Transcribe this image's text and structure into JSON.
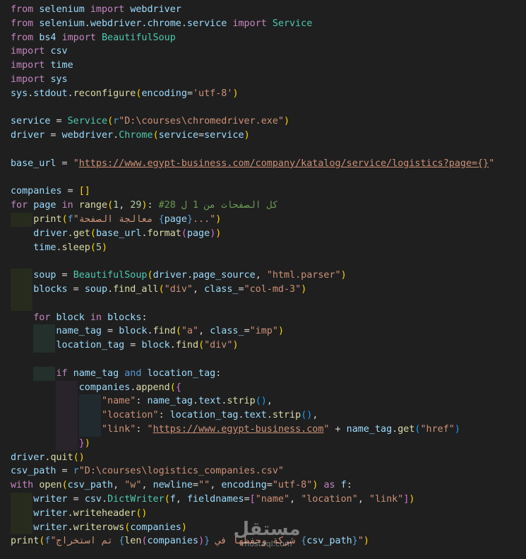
{
  "code_lines": [
    [
      [
        "k",
        "from"
      ],
      [
        "p",
        " "
      ],
      [
        "v",
        "selenium"
      ],
      [
        "p",
        " "
      ],
      [
        "k",
        "import"
      ],
      [
        "p",
        " "
      ],
      [
        "v",
        "webdriver"
      ]
    ],
    [
      [
        "k",
        "from"
      ],
      [
        "p",
        " "
      ],
      [
        "v",
        "selenium.webdriver.chrome.service"
      ],
      [
        "p",
        " "
      ],
      [
        "k",
        "import"
      ],
      [
        "p",
        " "
      ],
      [
        "c",
        "Service"
      ]
    ],
    [
      [
        "k",
        "from"
      ],
      [
        "p",
        " "
      ],
      [
        "v",
        "bs4"
      ],
      [
        "p",
        " "
      ],
      [
        "k",
        "import"
      ],
      [
        "p",
        " "
      ],
      [
        "c",
        "BeautifulSoup"
      ]
    ],
    [
      [
        "k",
        "import"
      ],
      [
        "p",
        " "
      ],
      [
        "v",
        "csv"
      ]
    ],
    [
      [
        "k",
        "import"
      ],
      [
        "p",
        " "
      ],
      [
        "v",
        "time"
      ]
    ],
    [
      [
        "k",
        "import"
      ],
      [
        "p",
        " "
      ],
      [
        "v",
        "sys"
      ]
    ],
    [
      [
        "v",
        "sys"
      ],
      [
        "p",
        "."
      ],
      [
        "v",
        "stdout"
      ],
      [
        "p",
        "."
      ],
      [
        "f",
        "reconfigure"
      ],
      [
        "p1",
        "("
      ],
      [
        "v",
        "encoding"
      ],
      [
        "p",
        "="
      ],
      [
        "s",
        "'utf-8'"
      ],
      [
        "p1",
        ")"
      ]
    ],
    [],
    [
      [
        "v",
        "service"
      ],
      [
        "p",
        " = "
      ],
      [
        "c",
        "Service"
      ],
      [
        "p1",
        "("
      ],
      [
        "b",
        "r"
      ],
      [
        "s",
        "\"D:\\courses\\chromedriver.exe\""
      ],
      [
        "p1",
        ")"
      ]
    ],
    [
      [
        "v",
        "driver"
      ],
      [
        "p",
        " = "
      ],
      [
        "v",
        "webdriver"
      ],
      [
        "p",
        "."
      ],
      [
        "c",
        "Chrome"
      ],
      [
        "p1",
        "("
      ],
      [
        "v",
        "service"
      ],
      [
        "p",
        "="
      ],
      [
        "v",
        "service"
      ],
      [
        "p1",
        ")"
      ]
    ],
    [],
    [
      [
        "v",
        "base_url"
      ],
      [
        "p",
        " = "
      ],
      [
        "s",
        "\""
      ],
      [
        "su",
        "https://www.egypt-business.com/company/katalog/service/logistics?page={}"
      ],
      [
        "s",
        "\""
      ]
    ],
    [],
    [
      [
        "v",
        "companies"
      ],
      [
        "p",
        " = "
      ],
      [
        "p1",
        "[]"
      ]
    ],
    [
      [
        "k",
        "for"
      ],
      [
        "p",
        " "
      ],
      [
        "v",
        "page"
      ],
      [
        "p",
        " "
      ],
      [
        "k",
        "in"
      ],
      [
        "p",
        " "
      ],
      [
        "f",
        "range"
      ],
      [
        "p1",
        "("
      ],
      [
        "n",
        "1"
      ],
      [
        "p",
        ", "
      ],
      [
        "n",
        "29"
      ],
      [
        "p1",
        ")"
      ],
      [
        "p",
        ": "
      ],
      [
        "cm",
        "#28 كل الصفحات من 1 ل"
      ]
    ],
    [
      [
        "p",
        "    "
      ],
      [
        "f",
        "print"
      ],
      [
        "p1",
        "("
      ],
      [
        "b",
        "f"
      ],
      [
        "s",
        "\"معالجة الصفحة "
      ],
      [
        "b",
        "{"
      ],
      [
        "v",
        "page"
      ],
      [
        "b",
        "}"
      ],
      [
        "s",
        "...\""
      ],
      [
        "p1",
        ")"
      ]
    ],
    [
      [
        "p",
        "    "
      ],
      [
        "v",
        "driver"
      ],
      [
        "p",
        "."
      ],
      [
        "f",
        "get"
      ],
      [
        "p1",
        "("
      ],
      [
        "v",
        "base_url"
      ],
      [
        "p",
        "."
      ],
      [
        "f",
        "format"
      ],
      [
        "p2",
        "("
      ],
      [
        "v",
        "page"
      ],
      [
        "p2",
        ")"
      ],
      [
        "p1",
        ")"
      ]
    ],
    [
      [
        "p",
        "    "
      ],
      [
        "v",
        "time"
      ],
      [
        "p",
        "."
      ],
      [
        "f",
        "sleep"
      ],
      [
        "p1",
        "("
      ],
      [
        "n",
        "5"
      ],
      [
        "p1",
        ")"
      ]
    ],
    [],
    [
      [
        "p",
        "    "
      ],
      [
        "v",
        "soup"
      ],
      [
        "p",
        " = "
      ],
      [
        "c",
        "BeautifulSoup"
      ],
      [
        "p1",
        "("
      ],
      [
        "v",
        "driver"
      ],
      [
        "p",
        "."
      ],
      [
        "v",
        "page_source"
      ],
      [
        "p",
        ", "
      ],
      [
        "s",
        "\"html.parser\""
      ],
      [
        "p1",
        ")"
      ]
    ],
    [
      [
        "p",
        "    "
      ],
      [
        "v",
        "blocks"
      ],
      [
        "p",
        " = "
      ],
      [
        "v",
        "soup"
      ],
      [
        "p",
        "."
      ],
      [
        "f",
        "find_all"
      ],
      [
        "p1",
        "("
      ],
      [
        "s",
        "\"div\""
      ],
      [
        "p",
        ", "
      ],
      [
        "v",
        "class_"
      ],
      [
        "p",
        "="
      ],
      [
        "s",
        "\"col-md-3\""
      ],
      [
        "p1",
        ")"
      ]
    ],
    [],
    [
      [
        "p",
        "    "
      ],
      [
        "k",
        "for"
      ],
      [
        "p",
        " "
      ],
      [
        "v",
        "block"
      ],
      [
        "p",
        " "
      ],
      [
        "k",
        "in"
      ],
      [
        "p",
        " "
      ],
      [
        "v",
        "blocks"
      ],
      [
        "p",
        ":"
      ]
    ],
    [
      [
        "p",
        "        "
      ],
      [
        "v",
        "name_tag"
      ],
      [
        "p",
        " = "
      ],
      [
        "v",
        "block"
      ],
      [
        "p",
        "."
      ],
      [
        "f",
        "find"
      ],
      [
        "p1",
        "("
      ],
      [
        "s",
        "\"a\""
      ],
      [
        "p",
        ", "
      ],
      [
        "v",
        "class_"
      ],
      [
        "p",
        "="
      ],
      [
        "s",
        "\"imp\""
      ],
      [
        "p1",
        ")"
      ]
    ],
    [
      [
        "p",
        "        "
      ],
      [
        "v",
        "location_tag"
      ],
      [
        "p",
        " = "
      ],
      [
        "v",
        "block"
      ],
      [
        "p",
        "."
      ],
      [
        "f",
        "find"
      ],
      [
        "p1",
        "("
      ],
      [
        "s",
        "\"div\""
      ],
      [
        "p1",
        ")"
      ]
    ],
    [],
    [
      [
        "p",
        "        "
      ],
      [
        "k",
        "if"
      ],
      [
        "p",
        " "
      ],
      [
        "v",
        "name_tag"
      ],
      [
        "p",
        " "
      ],
      [
        "b",
        "and"
      ],
      [
        "p",
        " "
      ],
      [
        "v",
        "location_tag"
      ],
      [
        "p",
        ":"
      ]
    ],
    [
      [
        "p",
        "            "
      ],
      [
        "v",
        "companies"
      ],
      [
        "p",
        "."
      ],
      [
        "f",
        "append"
      ],
      [
        "p1",
        "("
      ],
      [
        "p2",
        "{"
      ]
    ],
    [
      [
        "p",
        "                "
      ],
      [
        "s",
        "\"name\""
      ],
      [
        "p",
        ": "
      ],
      [
        "v",
        "name_tag"
      ],
      [
        "p",
        "."
      ],
      [
        "v",
        "text"
      ],
      [
        "p",
        "."
      ],
      [
        "f",
        "strip"
      ],
      [
        "p3",
        "()"
      ],
      [
        "p",
        ","
      ]
    ],
    [
      [
        "p",
        "                "
      ],
      [
        "s",
        "\"location\""
      ],
      [
        "p",
        ": "
      ],
      [
        "v",
        "location_tag"
      ],
      [
        "p",
        "."
      ],
      [
        "v",
        "text"
      ],
      [
        "p",
        "."
      ],
      [
        "f",
        "strip"
      ],
      [
        "p3",
        "()"
      ],
      [
        "p",
        ","
      ]
    ],
    [
      [
        "p",
        "                "
      ],
      [
        "s",
        "\"link\""
      ],
      [
        "p",
        ": "
      ],
      [
        "s",
        "\""
      ],
      [
        "su",
        "https://www.egypt-business.com"
      ],
      [
        "s",
        "\""
      ],
      [
        "p",
        " + "
      ],
      [
        "v",
        "name_tag"
      ],
      [
        "p",
        "."
      ],
      [
        "f",
        "get"
      ],
      [
        "p3",
        "("
      ],
      [
        "s",
        "\"href\""
      ],
      [
        "p3",
        ")"
      ]
    ],
    [
      [
        "p",
        "            "
      ],
      [
        "p2",
        "}"
      ],
      [
        "p1",
        ")"
      ]
    ],
    [
      [
        "v",
        "driver"
      ],
      [
        "p",
        "."
      ],
      [
        "f",
        "quit"
      ],
      [
        "p1",
        "()"
      ]
    ],
    [
      [
        "v",
        "csv_path"
      ],
      [
        "p",
        " = "
      ],
      [
        "b",
        "r"
      ],
      [
        "s",
        "\"D:\\courses\\logistics_companies.csv\""
      ]
    ],
    [
      [
        "k",
        "with"
      ],
      [
        "p",
        " "
      ],
      [
        "f",
        "open"
      ],
      [
        "p1",
        "("
      ],
      [
        "v",
        "csv_path"
      ],
      [
        "p",
        ", "
      ],
      [
        "s",
        "\"w\""
      ],
      [
        "p",
        ", "
      ],
      [
        "v",
        "newline"
      ],
      [
        "p",
        "="
      ],
      [
        "s",
        "\"\""
      ],
      [
        "p",
        ", "
      ],
      [
        "v",
        "encoding"
      ],
      [
        "p",
        "="
      ],
      [
        "s",
        "\"utf-8\""
      ],
      [
        "p1",
        ")"
      ],
      [
        "p",
        " "
      ],
      [
        "k",
        "as"
      ],
      [
        "p",
        " "
      ],
      [
        "v",
        "f"
      ],
      [
        "p",
        ":"
      ]
    ],
    [
      [
        "p",
        "    "
      ],
      [
        "v",
        "writer"
      ],
      [
        "p",
        " = "
      ],
      [
        "v",
        "csv"
      ],
      [
        "p",
        "."
      ],
      [
        "c",
        "DictWriter"
      ],
      [
        "p1",
        "("
      ],
      [
        "v",
        "f"
      ],
      [
        "p",
        ", "
      ],
      [
        "v",
        "fieldnames"
      ],
      [
        "p",
        "="
      ],
      [
        "p2",
        "["
      ],
      [
        "s",
        "\"name\""
      ],
      [
        "p",
        ", "
      ],
      [
        "s",
        "\"location\""
      ],
      [
        "p",
        ", "
      ],
      [
        "s",
        "\"link\""
      ],
      [
        "p2",
        "]"
      ],
      [
        "p1",
        ")"
      ]
    ],
    [
      [
        "p",
        "    "
      ],
      [
        "v",
        "writer"
      ],
      [
        "p",
        "."
      ],
      [
        "f",
        "writeheader"
      ],
      [
        "p1",
        "()"
      ]
    ],
    [
      [
        "p",
        "    "
      ],
      [
        "v",
        "writer"
      ],
      [
        "p",
        "."
      ],
      [
        "f",
        "writerows"
      ],
      [
        "p1",
        "("
      ],
      [
        "v",
        "companies"
      ],
      [
        "p1",
        ")"
      ]
    ],
    [
      [
        "f",
        "print"
      ],
      [
        "p1",
        "("
      ],
      [
        "b",
        "f"
      ],
      [
        "s",
        "\"تم استخراج "
      ],
      [
        "b",
        "{"
      ],
      [
        "f",
        "len"
      ],
      [
        "p2",
        "("
      ],
      [
        "v",
        "companies"
      ],
      [
        "p2",
        ")"
      ],
      [
        "b",
        "}"
      ],
      [
        "s",
        " شركة وحفظها في "
      ],
      [
        "b",
        "{"
      ],
      [
        "v",
        "csv_path"
      ],
      [
        "b",
        "}"
      ],
      [
        "s",
        "\""
      ],
      [
        "p1",
        ")"
      ]
    ]
  ],
  "watermark": {
    "logo": "مستقل",
    "site": "mostaql.com"
  },
  "colors": {
    "background": "#1f1f1f",
    "keyword": "#c586c0",
    "variable": "#9cdcfe",
    "function": "#dcdcaa",
    "class": "#4ec9b0",
    "string": "#ce9178",
    "number": "#b5cea8",
    "comment": "#6a9955",
    "indent_guide_1": "#262b1e",
    "indent_guide_2": "#24302b",
    "indent_guide_3": "#29232c",
    "indent_guide_4": "#212a2e"
  }
}
